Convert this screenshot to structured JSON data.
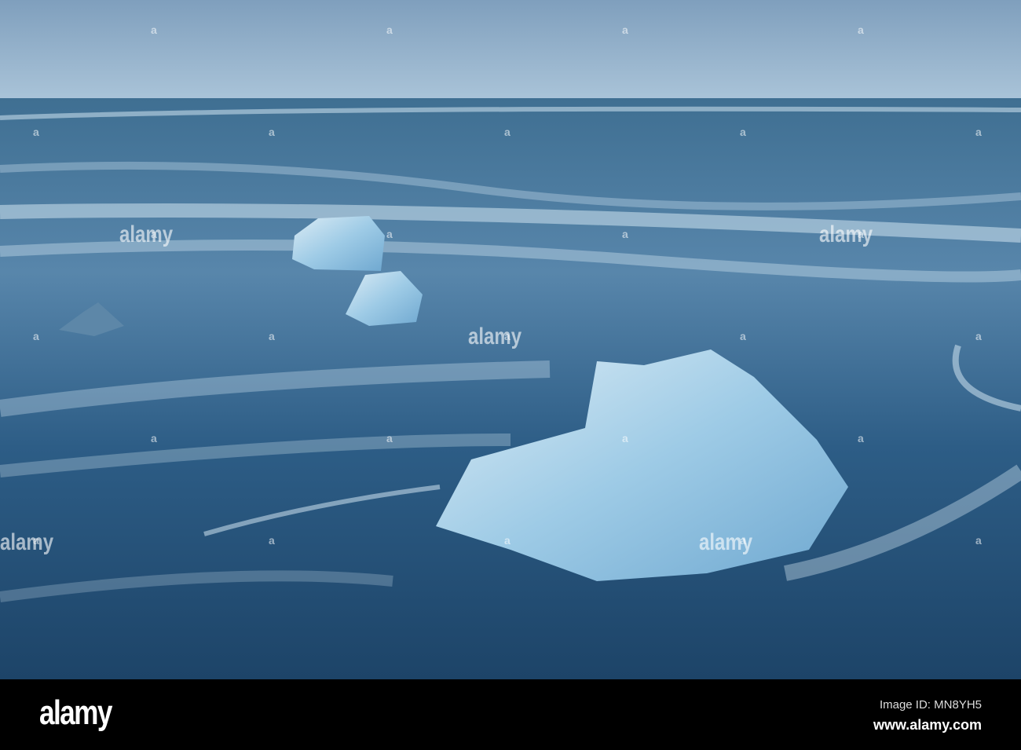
{
  "photo": {
    "alt_subject": "ice blocks on black sand beach with waves"
  },
  "watermark": {
    "text": "alamy",
    "mark": "a"
  },
  "footer": {
    "logo": "alamy",
    "image_id": "Image ID: MN8YH5",
    "website": "www.alamy.com"
  },
  "colors": {
    "sky": "#8fb0cc",
    "sea": "#3e6f96",
    "sand": "#1f4a6f",
    "ice": "#b9dcef"
  }
}
